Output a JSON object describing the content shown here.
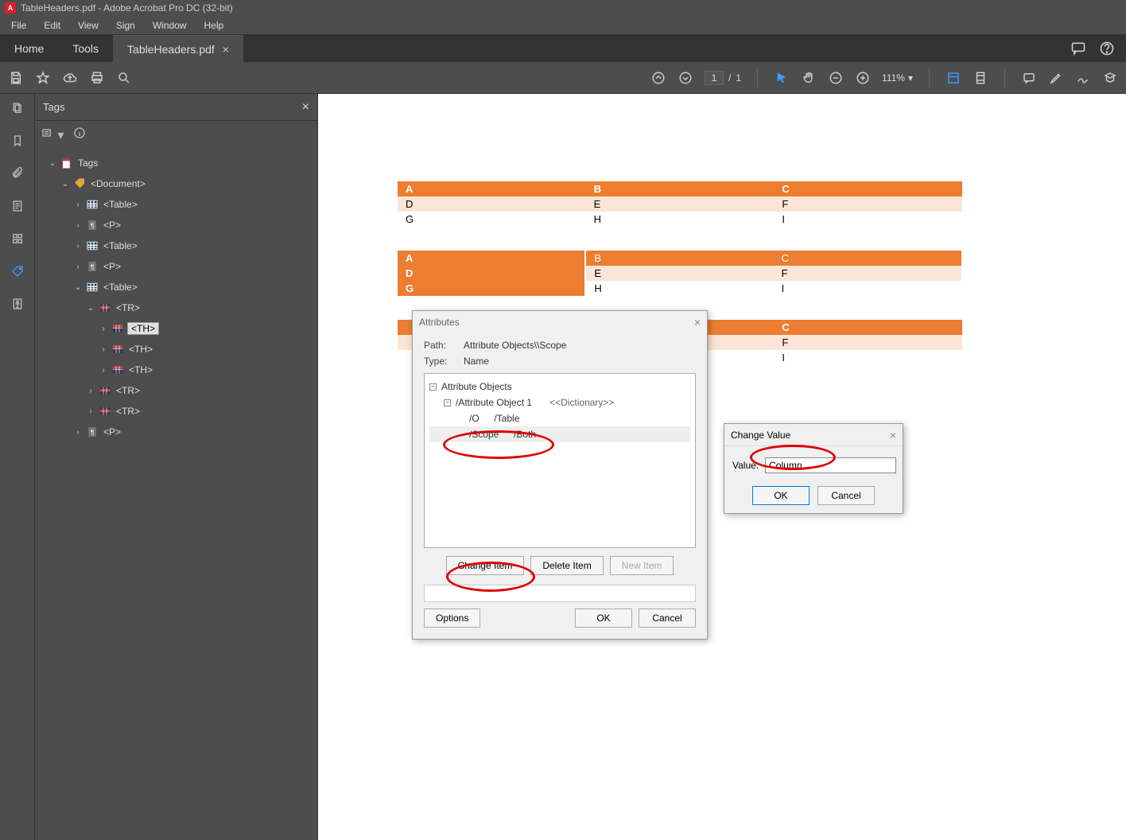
{
  "titlebar": {
    "text": "TableHeaders.pdf - Adobe Acrobat Pro DC (32-bit)"
  },
  "menubar": [
    "File",
    "Edit",
    "View",
    "Sign",
    "Window",
    "Help"
  ],
  "apptabs": {
    "home": "Home",
    "tools": "Tools",
    "doc": "TableHeaders.pdf"
  },
  "toolbar": {
    "page_current": "1",
    "page_sep": "/",
    "page_total": "1",
    "zoom": "111%"
  },
  "tagspanel": {
    "title": "Tags",
    "tree": [
      {
        "depth": 0,
        "caret": "v",
        "icon": "tags-root",
        "label": "Tags"
      },
      {
        "depth": 1,
        "caret": "v",
        "icon": "doc-tag",
        "label": "<Document>"
      },
      {
        "depth": 2,
        "caret": ">",
        "icon": "table",
        "label": "<Table>"
      },
      {
        "depth": 2,
        "caret": ">",
        "icon": "p",
        "label": "<P>"
      },
      {
        "depth": 2,
        "caret": ">",
        "icon": "table",
        "label": "<Table>"
      },
      {
        "depth": 2,
        "caret": ">",
        "icon": "p",
        "label": "<P>"
      },
      {
        "depth": 2,
        "caret": "v",
        "icon": "table",
        "label": "<Table>"
      },
      {
        "depth": 3,
        "caret": "v",
        "icon": "tr",
        "label": "<TR>"
      },
      {
        "depth": 4,
        "caret": ">",
        "icon": "th",
        "label": "<TH>",
        "selected": true
      },
      {
        "depth": 4,
        "caret": ">",
        "icon": "th",
        "label": "<TH>"
      },
      {
        "depth": 4,
        "caret": ">",
        "icon": "th",
        "label": "<TH>"
      },
      {
        "depth": 3,
        "caret": ">",
        "icon": "tr",
        "label": "<TR>"
      },
      {
        "depth": 3,
        "caret": ">",
        "icon": "tr",
        "label": "<TR>"
      },
      {
        "depth": 2,
        "caret": ">",
        "icon": "p",
        "label": "<P>"
      }
    ]
  },
  "doc_tables": [
    {
      "rows": [
        {
          "cells": [
            "A",
            "B",
            "C"
          ],
          "style": "hdr"
        },
        {
          "cells": [
            "D",
            "E",
            "F"
          ],
          "style": "lt"
        },
        {
          "cells": [
            "G",
            "H",
            "I"
          ],
          "style": "wh"
        }
      ]
    },
    {
      "rows": [
        {
          "cells": [
            "A",
            "B",
            "C"
          ],
          "style": "colhdr"
        },
        {
          "cells": [
            "D",
            "E",
            "F"
          ],
          "style": "colhdr-lt"
        },
        {
          "cells": [
            "G",
            "H",
            "I"
          ],
          "style": "colhdr-wh"
        }
      ]
    },
    {
      "rows": [
        {
          "cells": [
            "",
            "",
            "C"
          ],
          "style": "hdr"
        },
        {
          "cells": [
            "",
            "",
            "F"
          ],
          "style": "lt"
        },
        {
          "cells": [
            "",
            "",
            "I"
          ],
          "style": "wh"
        }
      ]
    }
  ],
  "attr_dialog": {
    "title": "Attributes",
    "path_label": "Path:",
    "path_value": "Attribute Objects\\\\Scope",
    "type_label": "Type:",
    "type_value": "Name",
    "tree": {
      "root": "Attribute Objects",
      "obj": "/Attribute Object  1",
      "obj_type": "<<Dictionary>>",
      "rows": [
        {
          "key": "/O",
          "val": "/Table"
        },
        {
          "key": "/Scope",
          "val": "/Both",
          "sel": true
        }
      ]
    },
    "btn_change": "Change Item",
    "btn_delete": "Delete Item",
    "btn_new": "New Item",
    "btn_options": "Options",
    "btn_ok": "OK",
    "btn_cancel": "Cancel"
  },
  "cv_dialog": {
    "title": "Change Value",
    "label": "Value:",
    "value": "Column",
    "ok": "OK",
    "cancel": "Cancel"
  }
}
